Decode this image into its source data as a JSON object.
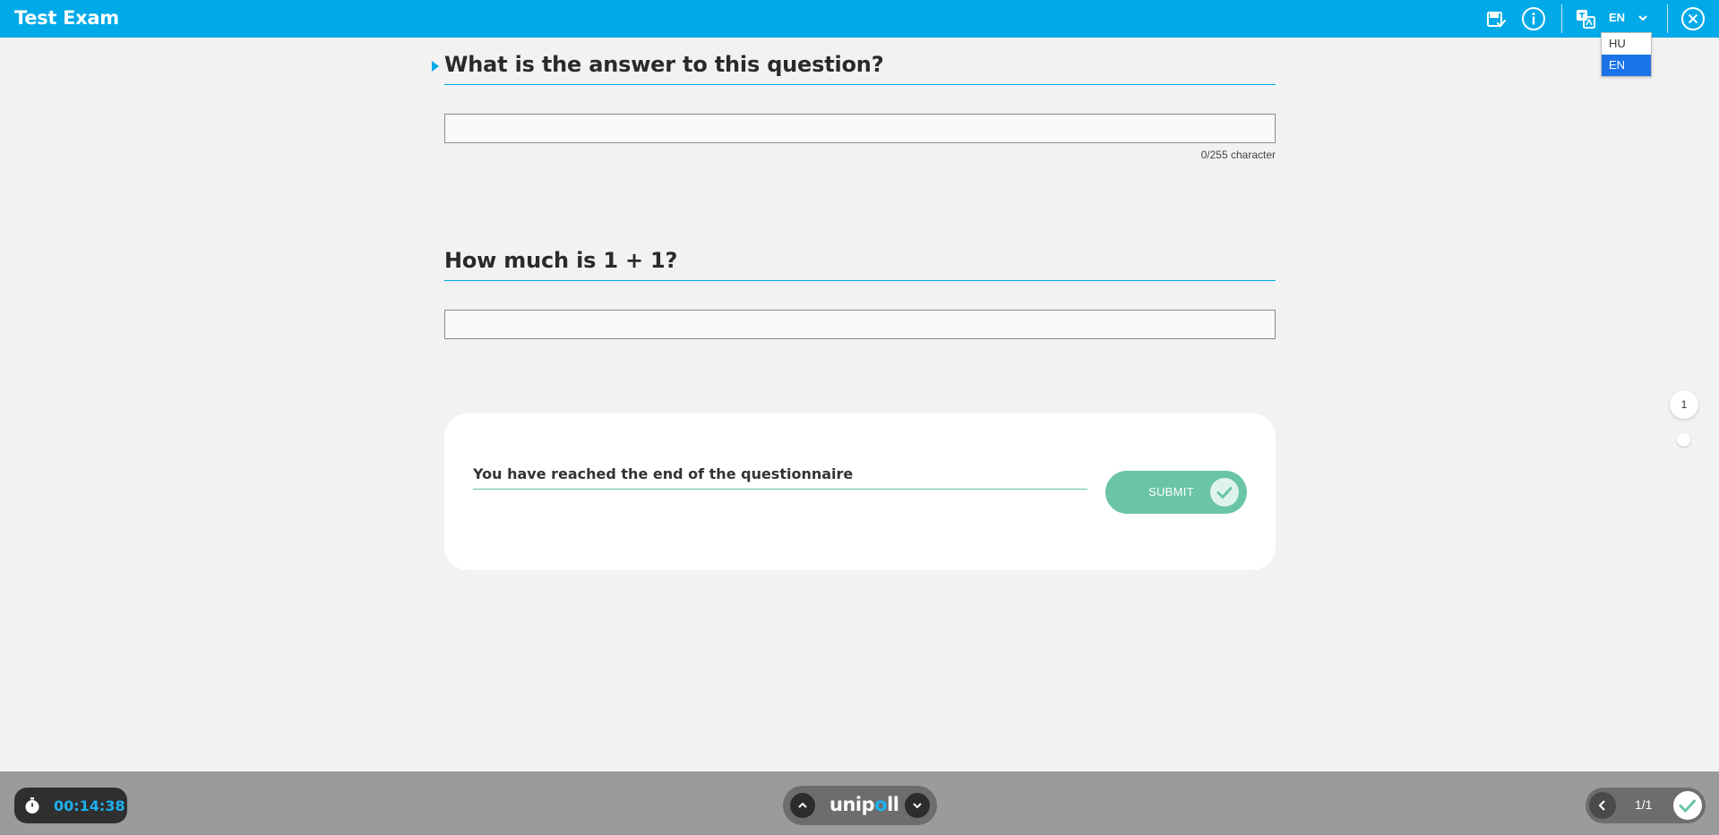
{
  "header": {
    "title": "Test Exam",
    "language": {
      "current": "EN",
      "options": [
        "HU",
        "EN"
      ],
      "selected": "EN"
    },
    "icons": [
      "save-progress-icon",
      "info-icon",
      "translate-icon",
      "chevron-down-icon",
      "close-icon"
    ],
    "accent_color": "#00a9e8"
  },
  "questions": [
    {
      "title": "What is the answer to this question?",
      "answer_value": "",
      "char_counter": "0/255 character",
      "active": true
    },
    {
      "title": "How much is 1 + 1?",
      "answer_value": ""
    }
  ],
  "end_card": {
    "message": "You have reached the end of the questionnaire",
    "submit_label": "SUBMIT",
    "submit_color": "#6ac4a8"
  },
  "side_nav": {
    "page": "1"
  },
  "footer": {
    "timer": "00:14:38",
    "brand_prefix": "unip",
    "brand_accent": "o",
    "brand_suffix": "ll",
    "page_indicator": "1/1"
  }
}
